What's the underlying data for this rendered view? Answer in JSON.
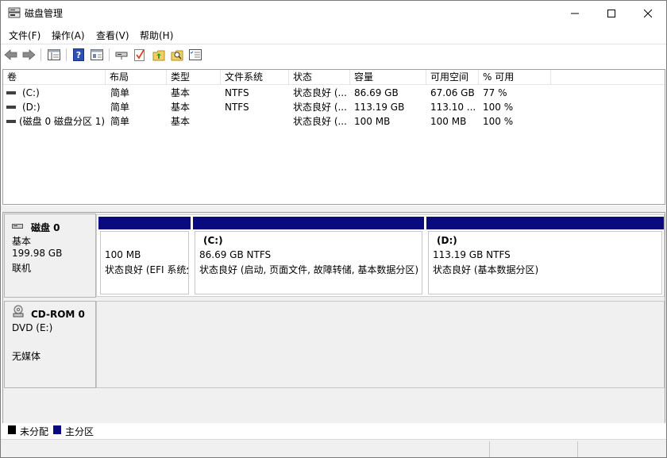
{
  "window": {
    "title": "磁盘管理",
    "app_icon": "disk-management-icon",
    "controls": [
      "minimize-icon",
      "maximize-icon",
      "close-icon"
    ]
  },
  "menu": {
    "items": [
      {
        "label": "文件(F)"
      },
      {
        "label": "操作(A)"
      },
      {
        "label": "查看(V)"
      },
      {
        "label": "帮助(H)"
      }
    ]
  },
  "toolbar": {
    "icons": [
      "back-arrow-icon",
      "forward-arrow-icon",
      "show-hide-tree-icon",
      "help-icon",
      "properties-icon",
      "connect-icon",
      "check-icon",
      "up-folder-icon",
      "search-icon",
      "list-view-icon"
    ]
  },
  "list": {
    "columns": [
      "卷",
      "布局",
      "类型",
      "文件系统",
      "状态",
      "容量",
      "可用空间",
      "% 可用"
    ],
    "rows": [
      {
        "volume": "(C:)",
        "layout": "简单",
        "type": "基本",
        "fs": "NTFS",
        "status": "状态良好 (...",
        "capacity": "86.69 GB",
        "free": "67.06 GB",
        "pct": "77 %"
      },
      {
        "volume": "(D:)",
        "layout": "简单",
        "type": "基本",
        "fs": "NTFS",
        "status": "状态良好 (...",
        "capacity": "113.19 GB",
        "free": "113.10 ...",
        "pct": "100 %"
      },
      {
        "volume": "(磁盘 0 磁盘分区 1)",
        "layout": "简单",
        "type": "基本",
        "fs": "",
        "status": "状态良好 (...",
        "capacity": "100 MB",
        "free": "100 MB",
        "pct": "100 %"
      }
    ]
  },
  "disks": [
    {
      "name": "磁盘 0",
      "type": "基本",
      "size": "199.98 GB",
      "state": "联机",
      "icon": "hard-disk-icon",
      "partitions": [
        {
          "label": "",
          "size": "100 MB",
          "status": "状态良好 (EFI 系统分区)"
        },
        {
          "label": "(C:)",
          "size": "86.69 GB NTFS",
          "status": "状态良好 (启动, 页面文件, 故障转储, 基本数据分区)"
        },
        {
          "label": "(D:)",
          "size": "113.19 GB NTFS",
          "status": "状态良好 (基本数据分区)"
        }
      ]
    },
    {
      "name": "CD-ROM 0",
      "type": "DVD (E:)",
      "state": "无媒体",
      "icon": "cd-rom-icon"
    }
  ],
  "legend": {
    "items": [
      {
        "label": "未分配",
        "color": "#000000"
      },
      {
        "label": "主分区",
        "color": "#0a0a80"
      }
    ]
  },
  "colors": {
    "primary_partition": "#0a0a80",
    "unallocated": "#000000"
  }
}
